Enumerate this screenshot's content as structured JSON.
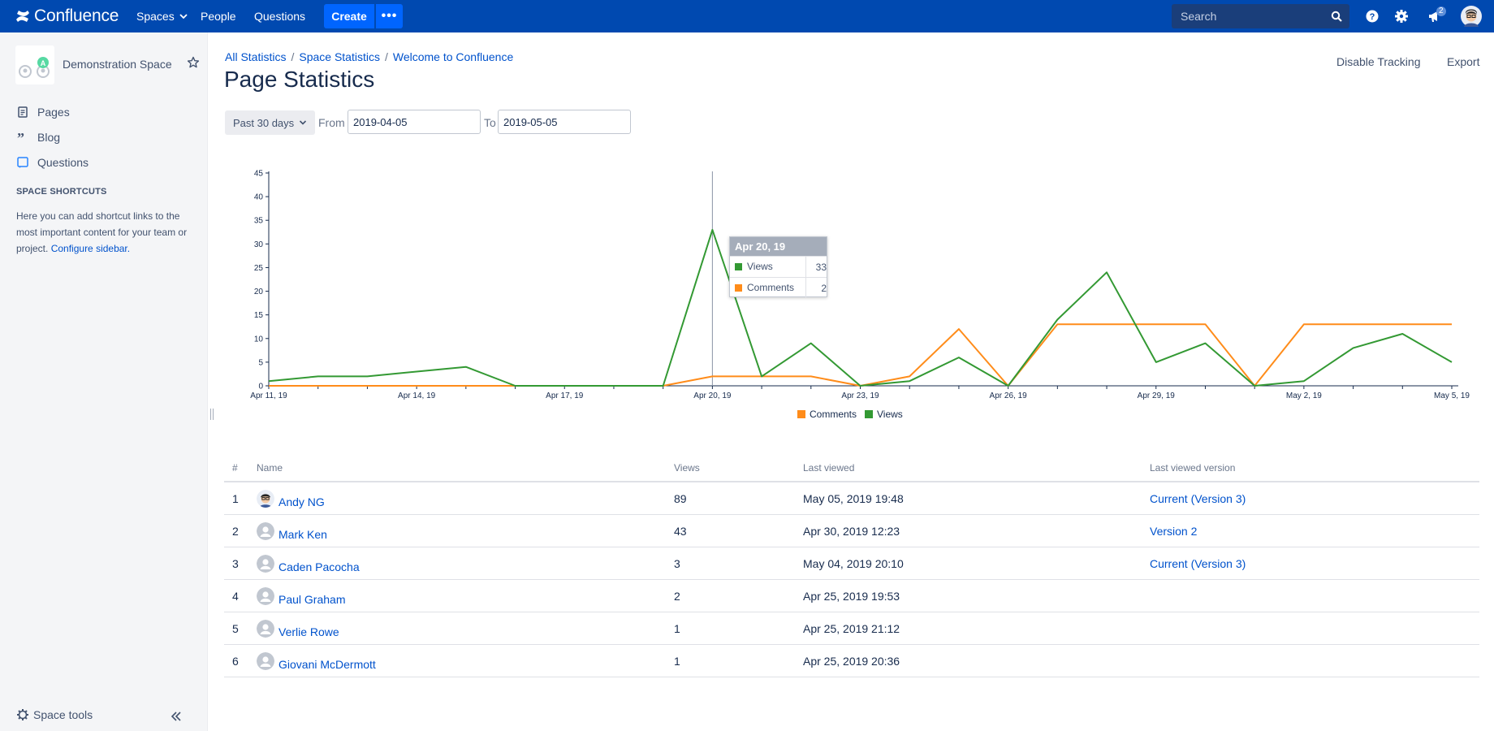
{
  "topnav": {
    "brand": "Confluence",
    "spaces_label": "Spaces",
    "people_label": "People",
    "questions_label": "Questions",
    "create_label": "Create",
    "more_label": "•••",
    "search_placeholder": "Search",
    "notification_count": "2"
  },
  "sidebar": {
    "space_name": "Demonstration Space",
    "items": [
      {
        "label": "Pages",
        "icon": "pages-icon"
      },
      {
        "label": "Blog",
        "icon": "blog-icon"
      },
      {
        "label": "Questions",
        "icon": "questions-icon"
      }
    ],
    "shortcuts_heading": "SPACE SHORTCUTS",
    "shortcuts_text": "Here you can add shortcut links to the most important content for your team or project.",
    "shortcuts_link": "Configure sidebar.",
    "space_tools": "Space tools"
  },
  "breadcrumb": [
    "All Statistics",
    "Space Statistics",
    "Welcome to Confluence"
  ],
  "page_title": "Page Statistics",
  "actions": {
    "disable_tracking": "Disable Tracking",
    "export": "Export"
  },
  "filters": {
    "period": "Past 30 days",
    "from_label": "From",
    "from_value": "2019-04-05",
    "to_label": "To",
    "to_value": "2019-05-05"
  },
  "colors": {
    "views": "#339933",
    "comments": "#ff8c1a",
    "brand": "#0049b0"
  },
  "chart_data": {
    "type": "line",
    "x": [
      "Apr 11, 19",
      "Apr 12, 19",
      "Apr 13, 19",
      "Apr 14, 19",
      "Apr 15, 19",
      "Apr 16, 19",
      "Apr 17, 19",
      "Apr 18, 19",
      "Apr 19, 19",
      "Apr 20, 19",
      "Apr 21, 19",
      "Apr 22, 19",
      "Apr 23, 19",
      "Apr 24, 19",
      "Apr 25, 19",
      "Apr 26, 19",
      "Apr 27, 19",
      "Apr 28, 19",
      "Apr 29, 19",
      "Apr 30, 19",
      "May 1, 19",
      "May 2, 19",
      "May 3, 19",
      "May 4, 19",
      "May 5, 19"
    ],
    "x_tick_labels": [
      "Apr 11, 19",
      "Apr 14, 19",
      "Apr 17, 19",
      "Apr 20, 19",
      "Apr 23, 19",
      "Apr 26, 19",
      "Apr 29, 19",
      "May 2, 19",
      "May 5, 19"
    ],
    "series": [
      {
        "name": "Comments",
        "values": [
          0,
          0,
          0,
          0,
          0,
          0,
          0,
          0,
          0,
          2,
          2,
          2,
          0,
          2,
          12,
          0,
          13,
          13,
          13,
          13,
          0,
          13,
          13,
          13,
          13
        ]
      },
      {
        "name": "Views",
        "values": [
          1,
          2,
          2,
          3,
          4,
          0,
          0,
          0,
          0,
          33,
          2,
          9,
          0,
          1,
          6,
          0,
          14,
          24,
          5,
          9,
          0,
          1,
          8,
          11,
          5
        ]
      }
    ],
    "ylim": [
      0,
      45
    ],
    "y_ticks": [
      0,
      5,
      10,
      15,
      20,
      25,
      30,
      35,
      40,
      45
    ],
    "grid": false,
    "legend_position": "bottom-center",
    "tooltip": {
      "title": "Apr 20, 19",
      "rows": [
        {
          "name": "Views",
          "value": "33"
        },
        {
          "name": "Comments",
          "value": "2"
        }
      ]
    }
  },
  "table": {
    "columns": [
      "#",
      "Name",
      "Views",
      "Last viewed",
      "Last viewed version"
    ],
    "rows": [
      {
        "num": "1",
        "name": "Andy NG",
        "views": "89",
        "last_viewed": "May 05, 2019 19:48",
        "version": "Current (Version 3)"
      },
      {
        "num": "2",
        "name": "Mark Ken",
        "views": "43",
        "last_viewed": "Apr 30, 2019 12:23",
        "version": "Version 2"
      },
      {
        "num": "3",
        "name": "Caden Pacocha",
        "views": "3",
        "last_viewed": "May 04, 2019 20:10",
        "version": "Current (Version 3)"
      },
      {
        "num": "4",
        "name": "Paul Graham",
        "views": "2",
        "last_viewed": "Apr 25, 2019 19:53",
        "version": ""
      },
      {
        "num": "5",
        "name": "Verlie Rowe",
        "views": "1",
        "last_viewed": "Apr 25, 2019 21:12",
        "version": ""
      },
      {
        "num": "6",
        "name": "Giovani McDermott",
        "views": "1",
        "last_viewed": "Apr 25, 2019 20:36",
        "version": ""
      }
    ]
  }
}
